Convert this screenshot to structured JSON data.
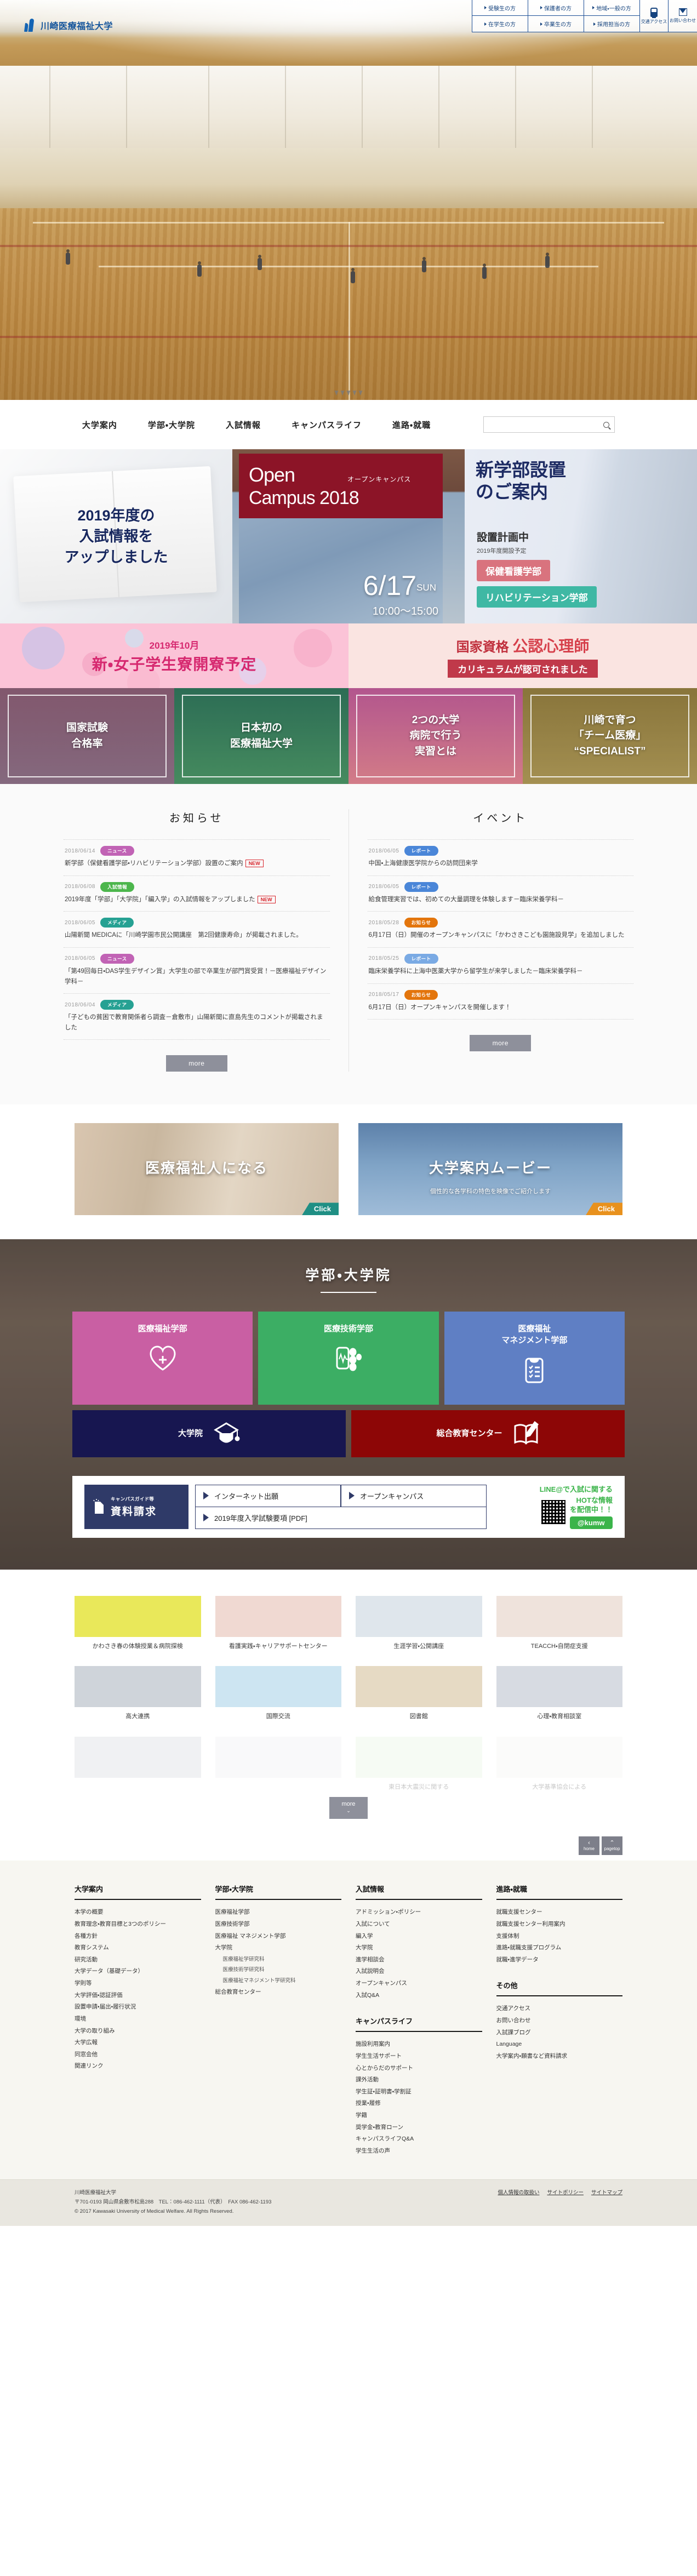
{
  "header": {
    "logo_text": "川崎医療福祉大学",
    "logo_icon": "kawasaki-logo-icon",
    "util_links": [
      "受験生の方",
      "保護者の方",
      "地域・一般の方",
      "在学生の方",
      "卒業生の方",
      "採用担当の方"
    ],
    "access_label": "交通アクセス",
    "contact_label": "お問い合わせ"
  },
  "gnav": {
    "items": [
      "大学案内",
      "学部・大学院",
      "入試情報",
      "キャンパスライフ",
      "進路・就職"
    ],
    "search_placeholder": "",
    "search_value": ""
  },
  "banners": {
    "left": {
      "line1": "2019年度の",
      "line2": "入試情報を",
      "line3": "アップしました"
    },
    "mid": {
      "title1": "Open",
      "title2": "Campus 2018",
      "subtitle": "オープンキャンパス",
      "date": "6/17",
      "day": "SUN",
      "time": "10:00〜15:00"
    },
    "right": {
      "title1": "新学部設置",
      "title2": "のご案内",
      "plan": "設置計画中",
      "plan_note": "2019年度開設予定",
      "pill1": "保健看護学部",
      "pill2": "リハビリテーション学部"
    },
    "pink_left": {
      "line1": "2019年10月",
      "line2": "新・女子学生寮開寮予定"
    },
    "pink_right": {
      "pre": "国家資格",
      "strong": "公認心理師",
      "band": "カリキュラムが認可されました"
    }
  },
  "features": [
    {
      "line1": "国家試験",
      "line2": "合格率"
    },
    {
      "line1": "日本初の",
      "line2": "医療福祉大学"
    },
    {
      "line1": "2つの大学",
      "line2": "病院で行う",
      "line3": "実習とは"
    },
    {
      "line1": "川崎で育つ",
      "line2": "「チーム医療」",
      "line3": "“SPECIALIST”"
    }
  ],
  "news": {
    "title": "お知らせ",
    "more_label": "more",
    "items": [
      {
        "date": "2018/06/14",
        "tag": "ニュース",
        "tag_color": "#c163b5",
        "text": "新学部（保健看護学部・リハビリテーション学部）設置のご案内",
        "new": "NEW"
      },
      {
        "date": "2018/06/08",
        "tag": "入試情報",
        "tag_color": "#4cb64c",
        "text": "2019年度「学部」「大学院」「編入学」の入試情報をアップしました",
        "new": "NEW"
      },
      {
        "date": "2018/06/05",
        "tag": "メディア",
        "tag_color": "#26a193",
        "text": "山陽新聞 MEDICAに「川崎学園市民公開講座　第2回健康寿命」が掲載されました。",
        "new": ""
      },
      {
        "date": "2018/06/05",
        "tag": "ニュース",
        "tag_color": "#c163b5",
        "text": "「第49回毎日・DAS学生デザイン賞」大学生の部で卒業生が部門賞受賞！－医療福祉デザイン学科－",
        "new": ""
      },
      {
        "date": "2018/06/04",
        "tag": "メディア",
        "tag_color": "#26a193",
        "text": "「子どもの貧困で教育関係者ら調査－倉敷市」山陽新聞に直島先生のコメントが掲載されました",
        "new": ""
      }
    ]
  },
  "events": {
    "title": "イベント",
    "more_label": "more",
    "items": [
      {
        "date": "2018/06/05",
        "tag": "レポート",
        "tag_color": "#4a86d8",
        "text": "中国・上海健康医学院からの訪問団来学"
      },
      {
        "date": "2018/06/05",
        "tag": "レポート",
        "tag_color": "#4a86d8",
        "text": "給食管理実習では、初めての大量調理を体験します－臨床栄養学科－"
      },
      {
        "date": "2018/05/28",
        "tag": "お知らせ",
        "tag_color": "#e3750c",
        "text": "6月17日（日）開催のオープンキャンパスに「かわさきこども園施設見学」を追加しました"
      },
      {
        "date": "2018/05/25",
        "tag": "レポート",
        "tag_color": "#7aaae4",
        "text": "臨床栄養学科に上海中医薬大学から留学生が来学しました－臨床栄養学科－"
      },
      {
        "date": "2018/05/17",
        "tag": "お知らせ",
        "tag_color": "#e3750c",
        "text": "6月17日（日）オープンキャンパスを開催します！"
      }
    ]
  },
  "promos": [
    {
      "title": "医療福祉人になる",
      "subtitle": "",
      "click": "Click"
    },
    {
      "title": "大学案内ムービー",
      "subtitle": "個性的な各学科の特色を映像でご紹介します",
      "click": "Click"
    }
  ],
  "faculty": {
    "heading": "学部・大学院",
    "cards": [
      {
        "label": "医療福祉学部",
        "icon": "heart-plus-icon",
        "color": "#c95fa3"
      },
      {
        "label": "医療技術学部",
        "icon": "vitals-monitor-icon",
        "color": "#3cae64"
      },
      {
        "label": "医療福祉\nマネジメント学部",
        "icon": "checklist-clipboard-icon",
        "color": "#5f7fc4"
      }
    ],
    "cards2": [
      {
        "label": "大学院",
        "icon": "graduation-cap-icon",
        "color": "#171650"
      },
      {
        "label": "総合教育センター",
        "icon": "book-pen-icon",
        "color": "#8d0606"
      }
    ],
    "request": {
      "logo_small": "キャンパスガイド等",
      "logo_big": "資料請求",
      "links": [
        "インターネット出願",
        "オープンキャンパス",
        "2019年度入学試験要項 [PDF]"
      ],
      "line_text1": "LINE@で入試に関する",
      "line_text2": "HOTな情報",
      "line_text3": "を配信中！！",
      "line_id": "@kumw",
      "qr_icon": "qr-code-icon"
    }
  },
  "photo_grid": {
    "more_label": "more",
    "items": [
      {
        "caption": "かわさき春の体験授業＆病院探検",
        "thumb": "spring-trial-class-thumb"
      },
      {
        "caption": "看護実践・キャリアサポートセンター",
        "thumb": "nursing-support-thumb"
      },
      {
        "caption": "生涯学習・公開講座",
        "thumb": "lifelong-learning-thumb"
      },
      {
        "caption": "TEACCH・自閉症支援",
        "thumb": "teacch-thumb"
      },
      {
        "caption": "高大連携",
        "thumb": "highschool-link-thumb"
      },
      {
        "caption": "国際交流",
        "thumb": "international-thumb"
      },
      {
        "caption": "図書館",
        "thumb": "library-thumb"
      },
      {
        "caption": "心理・教育相談室",
        "thumb": "counseling-thumb"
      },
      {
        "caption": "",
        "thumb": "group-photo-thumb"
      },
      {
        "caption": "",
        "thumb": "portrait-thumb"
      },
      {
        "caption": "東日本大震災に関する",
        "thumb": "earthquake-thumb"
      },
      {
        "caption": "大学基準協会による",
        "thumb": "accreditation-thumb"
      }
    ]
  },
  "totop": {
    "home_label": "home",
    "pagetop_label": "pagetop",
    "home_icon": "home-icon",
    "up-icon": "chevron-up-icon"
  },
  "footer": {
    "columns": [
      {
        "heading": "大学案内",
        "links": [
          "本学の概要",
          "教育理念・教育目標と3つのポリシー",
          "各種方針",
          "教育システム",
          "研究活動",
          "大学データ（基礎データ）",
          "学則等",
          "大学評価・認証評価",
          "設置申請・届出・履行状況",
          "環境",
          "大学の取り組み",
          "大学広報",
          "同窓会他",
          "関連リンク"
        ]
      },
      {
        "heading": "学部・大学院",
        "links": [
          "医療福祉学部",
          "医療技術学部",
          "医療福祉 マネジメント学部",
          "大学院"
        ],
        "sublinks": [
          "医療福祉学研究科",
          "医療技術学研究科",
          "医療福祉マネジメント学研究科"
        ],
        "tail": [
          "総合教育センター"
        ]
      },
      {
        "heading": "入試情報",
        "links": [
          "アドミッション・ポリシー",
          "入試について",
          "編入学",
          "大学院",
          "進学相談会",
          "入試説明会",
          "オープンキャンパス",
          "入試Q&A"
        ],
        "heading2": "キャンパスライフ",
        "links2": [
          "施設利用案内",
          "学生生活サポート",
          "心とからだのサポート",
          "課外活動",
          "学生証・証明書・学割証",
          "授業・履修",
          "学籍",
          "奨学金・教育ローン",
          "キャンパスライフQ&A",
          "学生生活の声"
        ]
      },
      {
        "heading": "進路・就職",
        "links": [
          "就職支援センター",
          "就職支援センター利用案内",
          "支援体制",
          "進路・就職支援プログラム",
          "就職・進学データ"
        ],
        "heading2": "その他",
        "links2": [
          "交通アクセス",
          "お問い合わせ",
          "入試課ブログ",
          "Language",
          "大学案内・願書など資料請求"
        ]
      }
    ],
    "org": "川崎医療福祉大学",
    "address": "〒701-0193 岡山県倉敷市松島288　TEL：086-462-1111（代表）　FAX 086-462-1193",
    "copyright": "© 2017 Kawasaki University of Medical Welfare. All Rights Reserved.",
    "bottom_links": [
      "個人情報の取扱い",
      "サイトポリシー",
      "サイトマップ"
    ]
  }
}
